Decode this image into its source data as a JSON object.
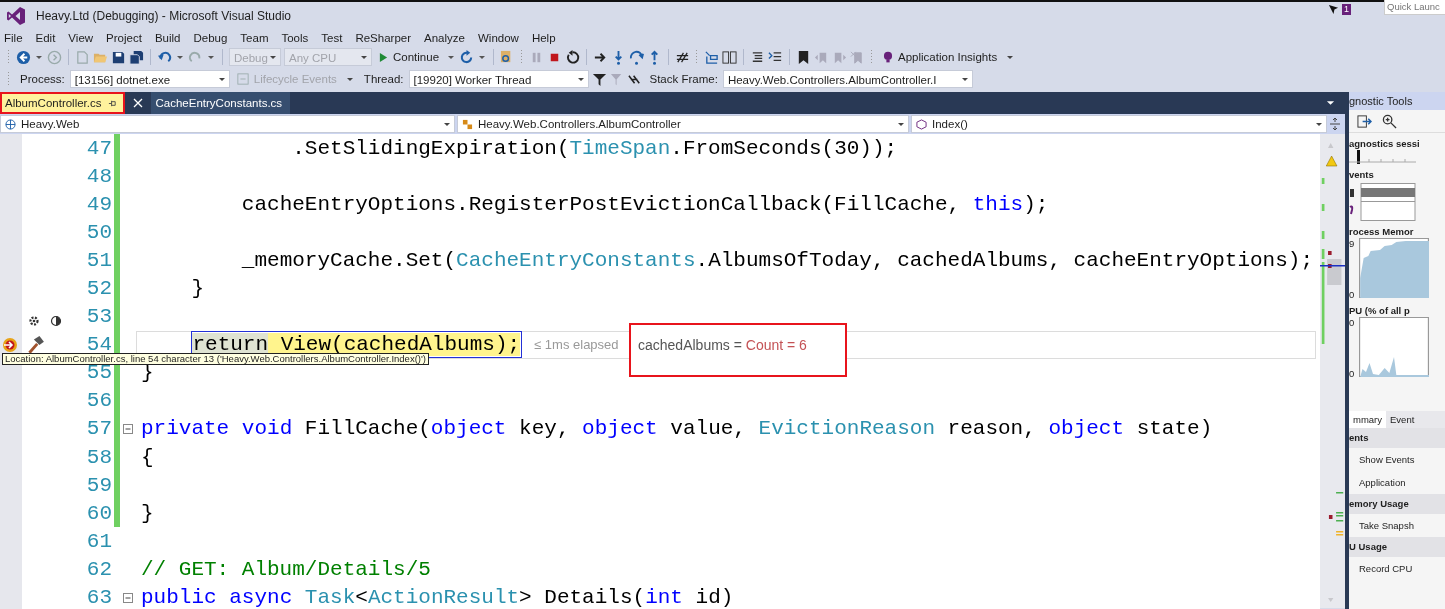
{
  "window": {
    "title": "Heavy.Ltd (Debugging) - Microsoft Visual Studio",
    "notification_count": "1",
    "quick_launch": {
      "placeholder": "Quick Launc"
    }
  },
  "menu": [
    "File",
    "Edit",
    "View",
    "Project",
    "Build",
    "Debug",
    "Team",
    "Tools",
    "Test",
    "ReSharper",
    "Analyze",
    "Window",
    "Help"
  ],
  "toolbar": {
    "configuration": {
      "value": "Debug",
      "disabled": true
    },
    "platform": {
      "value": "Any CPU",
      "disabled": true
    },
    "continue_button": "Continue",
    "insights_button": "Application Insights"
  },
  "debug_location": {
    "process_label": "Process:",
    "process": "[13156] dotnet.exe",
    "lifecycle": {
      "label": "Lifecycle Events",
      "disabled": true
    },
    "thread_label": "Thread:",
    "thread": "[19920] Worker Thread",
    "stack_frame_label": "Stack Frame:",
    "stack_frame": "Heavy.Web.Controllers.AlbumController.I"
  },
  "tabs": [
    {
      "label": "AlbumController.cs",
      "selected": true,
      "annotated": true
    },
    {
      "label": "CacheEntryConstants.cs",
      "selected": false,
      "annotated": false
    }
  ],
  "navigation": {
    "project": "Heavy.Web",
    "type": "Heavy.Web.Controllers.AlbumController",
    "member": "Index()"
  },
  "editor": {
    "lines": [
      {
        "number": "47",
        "changed": true,
        "collapsible": false,
        "current": false,
        "tokens": [
          {
            "text": "            .SetSlidingExpiration(",
            "kind": "plain"
          },
          {
            "text": "TimeSpan",
            "kind": "type"
          },
          {
            "text": ".FromSeconds(30));",
            "kind": "plain"
          }
        ]
      },
      {
        "number": "48",
        "changed": true,
        "collapsible": false,
        "current": false
      },
      {
        "number": "49",
        "changed": true,
        "collapsible": false,
        "current": false,
        "tokens": [
          {
            "text": "        cacheEntryOptions.RegisterPostEvictionCallback(FillCache, ",
            "kind": "plain"
          },
          {
            "text": "this",
            "kind": "keyword"
          },
          {
            "text": ");",
            "kind": "plain"
          }
        ]
      },
      {
        "number": "50",
        "changed": true,
        "collapsible": false,
        "current": false
      },
      {
        "number": "51",
        "changed": true,
        "collapsible": false,
        "current": false,
        "tokens": [
          {
            "text": "        _memoryCache.Set(",
            "kind": "plain"
          },
          {
            "text": "CacheEntryConstants",
            "kind": "type"
          },
          {
            "text": ".AlbumsOfToday, cachedAlbums, cacheEntryOptions);",
            "kind": "plain"
          }
        ]
      },
      {
        "number": "52",
        "changed": true,
        "collapsible": false,
        "current": false,
        "tokens": [
          {
            "text": "    }",
            "kind": "plain"
          }
        ]
      },
      {
        "number": "53",
        "changed": true,
        "collapsible": false,
        "current": false
      },
      {
        "number": "54",
        "changed": true,
        "collapsible": false,
        "current": true,
        "tokens": [
          {
            "text": "    return",
            "kind": "executed"
          },
          {
            "text": " View(cachedAlbums);",
            "kind": "next"
          }
        ]
      },
      {
        "number": "55",
        "changed": true,
        "collapsible": false,
        "current": false,
        "tokens": [
          {
            "text": "}",
            "kind": "plain"
          }
        ]
      },
      {
        "number": "56",
        "changed": true,
        "collapsible": false,
        "current": false
      },
      {
        "number": "57",
        "changed": true,
        "collapsible": true,
        "current": false,
        "tokens": [
          {
            "text": "private",
            "kind": "keyword"
          },
          {
            "text": " void",
            "kind": "keyword"
          },
          {
            "text": " FillCache(",
            "kind": "plain"
          },
          {
            "text": "object",
            "kind": "keyword"
          },
          {
            "text": " key, ",
            "kind": "plain"
          },
          {
            "text": "object",
            "kind": "keyword"
          },
          {
            "text": " value, ",
            "kind": "plain"
          },
          {
            "text": "EvictionReason",
            "kind": "type"
          },
          {
            "text": " reason, ",
            "kind": "plain"
          },
          {
            "text": "object",
            "kind": "keyword"
          },
          {
            "text": " state)",
            "kind": "plain"
          }
        ]
      },
      {
        "number": "58",
        "changed": true,
        "collapsible": false,
        "current": false,
        "tokens": [
          {
            "text": "{",
            "kind": "plain"
          }
        ]
      },
      {
        "number": "59",
        "changed": true,
        "collapsible": false,
        "current": false
      },
      {
        "number": "60",
        "changed": true,
        "collapsible": false,
        "current": false,
        "tokens": [
          {
            "text": "}",
            "kind": "plain"
          }
        ]
      },
      {
        "number": "61",
        "changed": false,
        "collapsible": false,
        "current": false
      },
      {
        "number": "62",
        "changed": false,
        "collapsible": false,
        "current": false,
        "tokens": [
          {
            "text": "// GET: Album/Details/5",
            "kind": "comment"
          }
        ]
      },
      {
        "number": "63",
        "changed": false,
        "collapsible": true,
        "current": false,
        "tokens": [
          {
            "text": "public",
            "kind": "keyword"
          },
          {
            "text": " async",
            "kind": "keyword"
          },
          {
            "text": " Task",
            "kind": "type"
          },
          {
            "text": "<",
            "kind": "plain"
          },
          {
            "text": "ActionResult",
            "kind": "type"
          },
          {
            "text": "> Details(",
            "kind": "plain"
          },
          {
            "text": "int",
            "kind": "keyword"
          },
          {
            "text": " id)",
            "kind": "plain"
          }
        ]
      }
    ],
    "perf_tip": "≤ 1ms elapsed",
    "datatip": {
      "name": "cachedAlbums =",
      "value": "Count = 6",
      "annotated": true
    },
    "location_tooltip": "Location: AlbumController.cs, line 54 character 13 ('Heavy.Web.Controllers.AlbumController.Index()')"
  },
  "diagnostics": {
    "title": "gnostic Tools",
    "session": "agnostics sessi",
    "events": "vents",
    "memory": {
      "label": "rocess Memor",
      "max": "9",
      "min": "0"
    },
    "cpu": {
      "label": "PU (% of all p",
      "max": "0",
      "min": "0"
    },
    "tabs": [
      {
        "label": "mmary",
        "selected": true
      },
      {
        "label": "Event",
        "selected": false
      }
    ],
    "sections": [
      {
        "header": "ents",
        "action": "Show Events"
      },
      {
        "action": "Application"
      },
      {
        "header": "emory Usage",
        "action": "Take Snapsh"
      },
      {
        "header": "U Usage",
        "action": "Record CPU"
      }
    ]
  }
}
